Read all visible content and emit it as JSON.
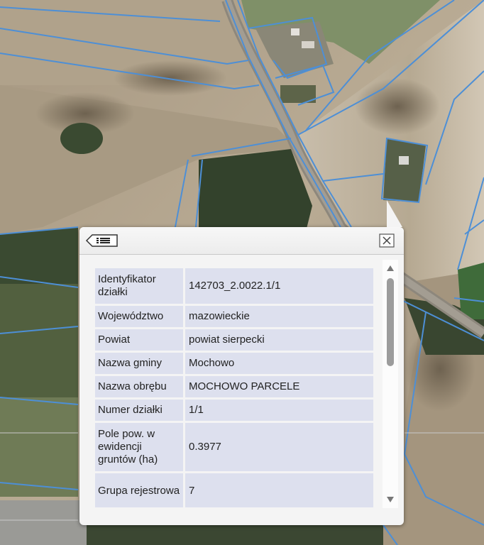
{
  "map": {
    "icons": {
      "back": "list-back-icon",
      "close": "close-icon"
    },
    "colors": {
      "parcel_border": "#4d8fd6",
      "field": "#b3a48d",
      "forest": "#33422c",
      "road": "#8f8a80"
    }
  },
  "popup": {
    "rows": [
      {
        "key": "Identyfikator działki",
        "value": "142703_2.0022.1/1"
      },
      {
        "key": "Województwo",
        "value": "mazowieckie"
      },
      {
        "key": "Powiat",
        "value": "powiat sierpecki"
      },
      {
        "key": "Nazwa gminy",
        "value": "Mochowo"
      },
      {
        "key": "Nazwa obrębu",
        "value": "MOCHOWO PARCELE"
      },
      {
        "key": "Numer działki",
        "value": "1/1"
      },
      {
        "key": "Pole pow. w ewidencji gruntów (ha)",
        "value": "0.3977"
      },
      {
        "key": "Grupa rejestrowa",
        "value": "7"
      }
    ],
    "scroll_position": 0.0
  }
}
